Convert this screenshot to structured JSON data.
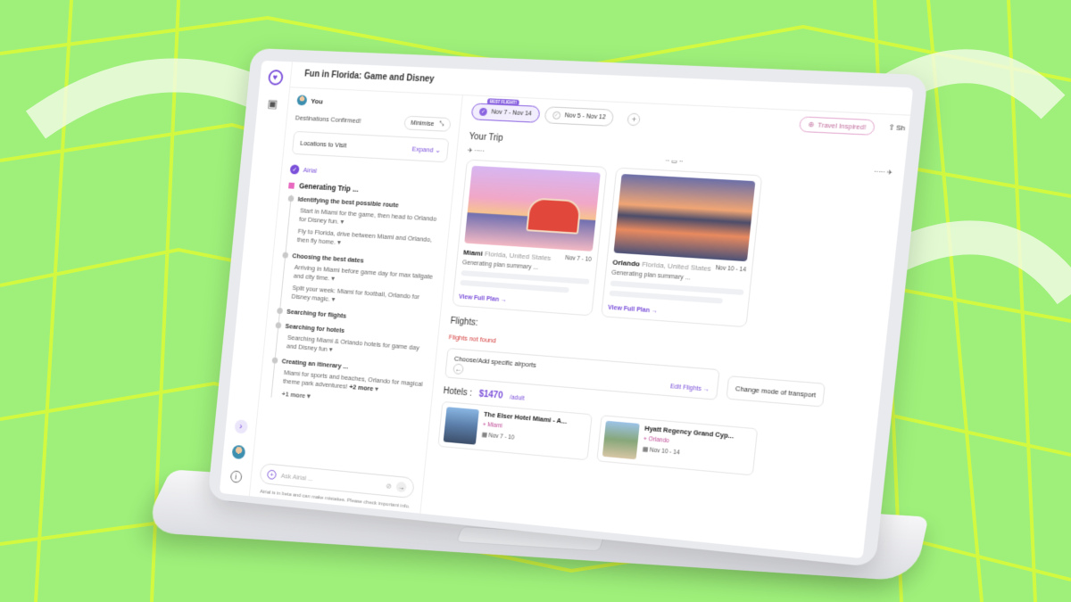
{
  "window": {
    "title": "Fun in Florida: Game and Disney"
  },
  "rail": {
    "icons": [
      "logo-icon",
      "suitcase-icon",
      "chevron-right-icon",
      "avatar",
      "info-icon"
    ]
  },
  "chat": {
    "user_name": "You",
    "confirmed": "Destinations Confirmed!",
    "minimise_label": "Minimise",
    "locations_label": "Locations to Visit",
    "expand_label": "Expand",
    "assistant_name": "Airial",
    "generating": "Generating Trip ...",
    "steps": [
      {
        "title": "Identifying the best possible route",
        "items": [
          "Start in Miami for the game, then head to Orlando for Disney fun.",
          "Fly to Florida, drive between Miami and Orlando, then fly home."
        ]
      },
      {
        "title": "Choosing the best dates",
        "items": [
          "Arriving in Miami before game day for max tailgate and city time.",
          "Split your week: Miami for football, Orlando for Disney magic."
        ]
      },
      {
        "title": "Searching for flights",
        "items": []
      },
      {
        "title": "Searching for hotels",
        "items": [
          "Searching Miami & Orlando hotels for game day and Disney fun"
        ]
      },
      {
        "title": "Creating an itinerary ...",
        "items": [
          "Miami for sports and beaches, Orlando for magical theme park adventures!"
        ]
      }
    ],
    "more_inline": "+2 more",
    "more": "+1 more",
    "ask_placeholder": "Ask Airial ...",
    "disclaimer": "Airial is in beta and can make mistakes. Please check important info."
  },
  "main": {
    "date_options": [
      {
        "badge": "BEST FLIGHT!",
        "label": "Nov 7 - Nov 14",
        "selected": true
      },
      {
        "badge": "",
        "label": "Nov 5 - Nov 12",
        "selected": false
      }
    ],
    "travel_inspired": "Travel Inspired!",
    "share": "Sh",
    "your_trip": "Your Trip",
    "destinations": [
      {
        "city": "Miami",
        "region": "Florida, United States",
        "dates": "Nov 7 - 10",
        "status": "Generating plan summary ...",
        "link": "View Full Plan"
      },
      {
        "city": "Orlando",
        "region": "Florida, United States",
        "dates": "Nov 10 - 14",
        "status": "Generating plan summary ...",
        "link": "View Full Plan"
      }
    ],
    "flights_label": "Flights:",
    "flights_error": "Flights not found",
    "airports_label": "Choose/Add specific airports",
    "edit_flights": "Edit Flights",
    "transport_label": "Change mode of transport",
    "hotels_label": "Hotels :",
    "hotels_price": "$1470",
    "hotels_unit": "/adult",
    "hotels": [
      {
        "name": "The Elser Hotel Miami - A...",
        "city": "Miami",
        "dates": "Nov 7 - 10"
      },
      {
        "name": "Hyatt Regency Grand Cyp...",
        "city": "Orlando",
        "dates": "Nov 10 - 14"
      }
    ]
  },
  "colors": {
    "accent": "#7a4fd9",
    "error": "#d43b3b",
    "background": "#9ef07a"
  }
}
